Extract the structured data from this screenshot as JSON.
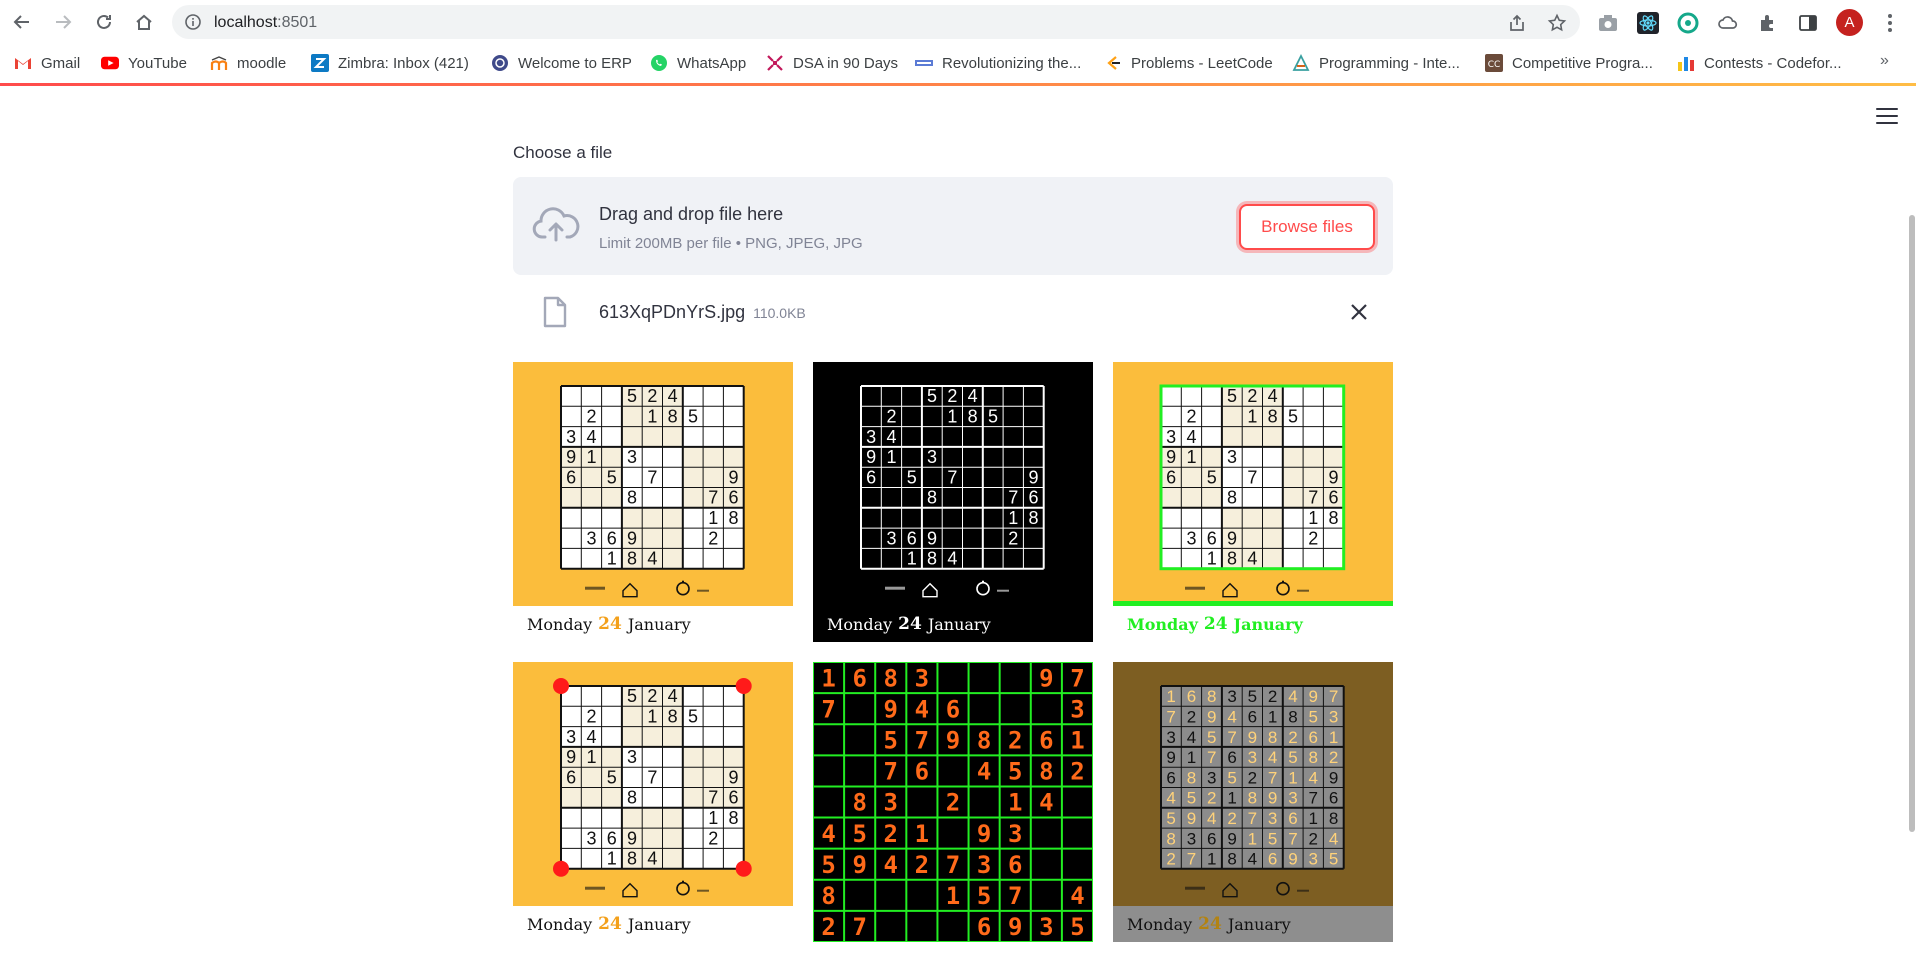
{
  "browser": {
    "url_host": "localhost",
    "url_port": ":8501",
    "avatar_letter": "A",
    "bookmarks": [
      {
        "label": "Gmail",
        "icon": "gmail-icon"
      },
      {
        "label": "YouTube",
        "icon": "youtube-icon"
      },
      {
        "label": "moodle",
        "icon": "moodle-icon"
      },
      {
        "label": "Zimbra: Inbox (421)",
        "icon": "zimbra-icon"
      },
      {
        "label": "Welcome to ERP",
        "icon": "erp-icon"
      },
      {
        "label": "WhatsApp",
        "icon": "whatsapp-icon"
      },
      {
        "label": "DSA in 90 Days",
        "icon": "dsa-icon"
      },
      {
        "label": "Revolutionizing the...",
        "icon": "revolutionizing-icon"
      },
      {
        "label": "Problems - LeetCode",
        "icon": "leetcode-icon"
      },
      {
        "label": "Programming - Inte...",
        "icon": "programming-icon"
      },
      {
        "label": "Competitive Progra...",
        "icon": "competitive-icon"
      },
      {
        "label": "Contests - Codefor...",
        "icon": "codeforces-icon"
      }
    ],
    "more_bookmarks": "»"
  },
  "uploader": {
    "label": "Choose a file",
    "drop_title": "Drag and drop file here",
    "drop_subtitle": "Limit 200MB per file • PNG, JPEG, JPG",
    "browse_label": "Browse files",
    "file_name": "613XqPDnYrS.jpg",
    "file_size": "110.0KB"
  },
  "puzzle": {
    "grid": [
      [
        0,
        0,
        0,
        5,
        2,
        4,
        0,
        0,
        0
      ],
      [
        0,
        2,
        0,
        0,
        1,
        8,
        5,
        0,
        0
      ],
      [
        3,
        4,
        0,
        0,
        0,
        0,
        0,
        0,
        0
      ],
      [
        9,
        1,
        0,
        3,
        0,
        0,
        0,
        0,
        0
      ],
      [
        6,
        0,
        5,
        0,
        7,
        0,
        0,
        0,
        9
      ],
      [
        0,
        0,
        0,
        8,
        0,
        0,
        0,
        7,
        6
      ],
      [
        0,
        0,
        0,
        0,
        0,
        0,
        0,
        1,
        8
      ],
      [
        0,
        3,
        6,
        9,
        0,
        0,
        0,
        2,
        0
      ],
      [
        0,
        0,
        1,
        8,
        4,
        0,
        0,
        0,
        0
      ]
    ],
    "caption_day": "Monday",
    "caption_date": "24",
    "caption_month": "January"
  },
  "solution_view": {
    "rows": [
      "168300097",
      "709460003",
      "005798261",
      "007604582",
      "083020140",
      "452109300",
      "594273600",
      "800015704",
      "270006935"
    ]
  },
  "solved_overlay": {
    "rows": [
      "168352497",
      "729461853",
      "345798261",
      "917634582",
      "683527149",
      "452189376",
      "594273618",
      "836915724",
      "271846935"
    ]
  },
  "colors": {
    "streamlit_red": "#ff4b4b",
    "tile_orange": "#fbbd3c",
    "detect_green": "#22ee22",
    "solution_orange": "#ff6a1a",
    "overlay_brown": "#7d5e22"
  }
}
